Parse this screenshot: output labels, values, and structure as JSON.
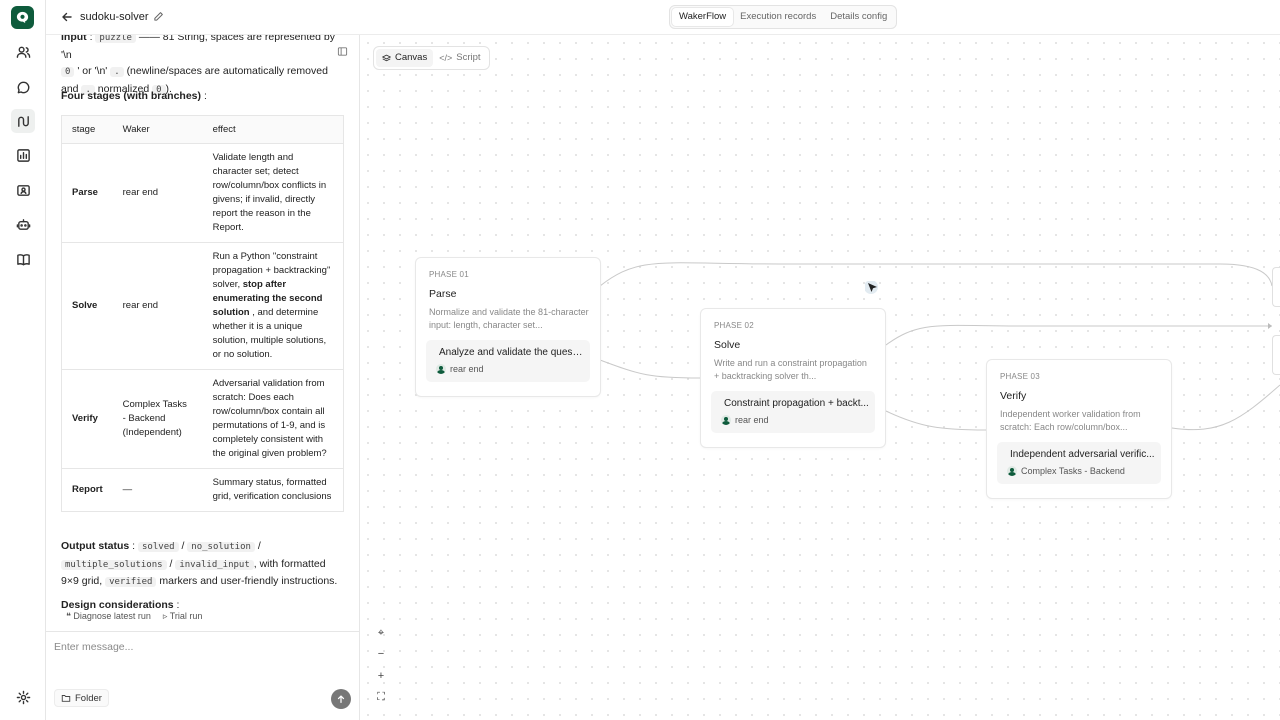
{
  "header": {
    "title": "sudoku-solver",
    "tabs": [
      {
        "label": "WakerFlow",
        "active": true
      },
      {
        "label": "Execution records",
        "active": false
      },
      {
        "label": "Details config",
        "active": false
      }
    ]
  },
  "rail": {
    "icons": [
      "users-icon",
      "chat-icon",
      "workflow-icon",
      "chart-icon",
      "contacts-icon",
      "robot-icon",
      "book-icon"
    ],
    "settings": "gear-icon"
  },
  "panel": {
    "input_label": "Input",
    "input_code": "puzzle",
    "input_text1": "—— 81 String, spaces are represented by '\\n",
    "input_code2": "0",
    "input_text2": "' or '\\n'",
    "input_code3": ".",
    "input_text3": "(newline/spaces are automatically removed and",
    "input_code4": ".",
    "input_text4": "normalized",
    "input_code5": "0",
    "input_text5": ").",
    "stages_heading": "Four stages (with branches)",
    "stages_suffix": ":",
    "table": {
      "headers": [
        "stage",
        "Waker",
        "effect"
      ],
      "rows": [
        {
          "stage": "Parse",
          "waker": "rear end",
          "effect": "Validate length and character set; detect row/column/box conflicts in givens; if invalid, directly report the reason in the Report."
        },
        {
          "stage": "Solve",
          "waker": "rear end",
          "effect_pre": "Run a Python \"constraint propagation + backtracking\" solver,",
          "effect_bold": "stop after enumerating the second solution",
          "effect_post": ", and determine whether it is a unique solution, multiple solutions, or no solution."
        },
        {
          "stage": "Verify",
          "waker": "Complex Tasks - Backend (Independent)",
          "effect": "Adversarial validation from scratch: Does each row/column/box contain all permutations of 1-9, and is completely consistent with the original given problem?"
        },
        {
          "stage": "Report",
          "waker": "—",
          "effect": "Summary status, formatted grid, verification conclusions"
        }
      ]
    },
    "output_label": "Output status",
    "output_codes": [
      "solved",
      "no_solution",
      "multiple_solutions",
      "invalid_input",
      "verified"
    ],
    "output_sep": "/",
    "output_text1": ", with formatted 9×9 grid,",
    "output_text2": "markers and user-friendly instructions.",
    "design_label": "Design considerations",
    "chips": [
      "Diagnose latest run",
      "Trial run"
    ],
    "message_placeholder": "Enter message...",
    "folder_label": "Folder"
  },
  "canvas": {
    "tabs": [
      {
        "label": "Canvas",
        "active": true
      },
      {
        "label": "Script",
        "active": false
      }
    ],
    "nodes": [
      {
        "phase": "PHASE 01",
        "title": "Parse",
        "desc": "Normalize and validate the 81-character input: length, character set...",
        "task": "Analyze and validate the questi...",
        "worker": "rear end"
      },
      {
        "phase": "PHASE 02",
        "title": "Solve",
        "desc": "Write and run a constraint propagation + backtracking solver th...",
        "task": "Constraint propagation + backt...",
        "worker": "rear end"
      },
      {
        "phase": "PHASE 03",
        "title": "Verify",
        "desc": "Independent worker validation from scratch: Each row/column/box...",
        "task": "Independent adversarial verific...",
        "worker": "Complex Tasks - Backend"
      }
    ],
    "zoom_controls": [
      "⌖",
      "−",
      "+",
      "⛶"
    ]
  },
  "colors": {
    "brand": "#0e5b3c",
    "border": "#e6e6e6"
  }
}
